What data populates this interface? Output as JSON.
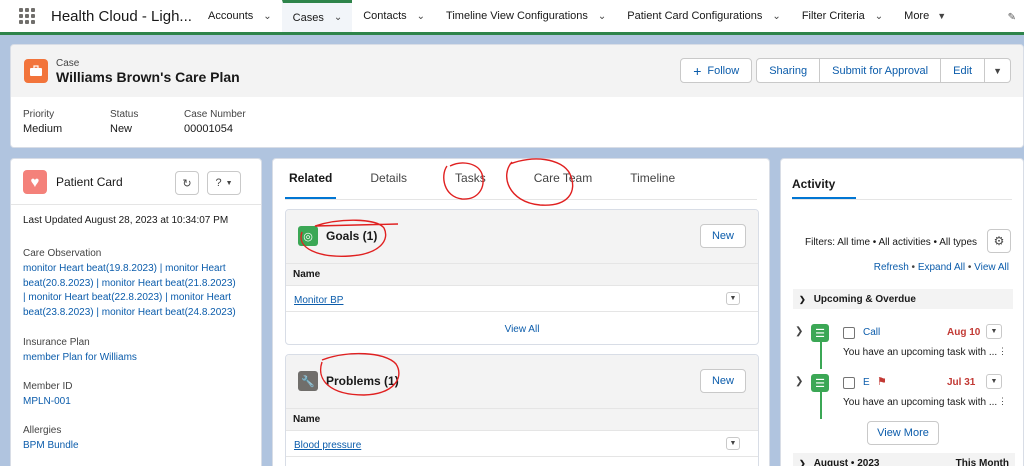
{
  "nav": {
    "app_name": "Health Cloud - Ligh...",
    "items": [
      {
        "label": "Accounts",
        "active": false
      },
      {
        "label": "Cases",
        "active": true
      },
      {
        "label": "Contacts",
        "active": false
      },
      {
        "label": "Timeline View Configurations",
        "active": false
      },
      {
        "label": "Patient Card Configurations",
        "active": false
      },
      {
        "label": "Filter Criteria",
        "active": false
      }
    ],
    "more_label": "More"
  },
  "record": {
    "object_type": "Case",
    "title": "Williams Brown's Care Plan",
    "follow_label": "Follow",
    "actions": [
      "Sharing",
      "Submit for Approval",
      "Edit"
    ],
    "fields": [
      {
        "label": "Priority",
        "value": "Medium"
      },
      {
        "label": "Status",
        "value": "New"
      },
      {
        "label": "Case Number",
        "value": "00001054"
      }
    ]
  },
  "patient_card": {
    "title": "Patient Card",
    "help_label": "?",
    "last_updated": "Last Updated August 28, 2023 at 10:34:07 PM",
    "care_observation": {
      "label": "Care Observation",
      "lines": [
        "monitor Heart beat(19.8.2023) | monitor Heart",
        "beat(20.8.2023) | monitor Heart beat(21.8.2023)",
        " | monitor Heart beat(22.8.2023) | monitor Heart",
        "beat(23.8.2023) | monitor Heart beat(24.8.2023)"
      ]
    },
    "insurance_plan": {
      "label": "Insurance Plan",
      "value": "member Plan for Williams"
    },
    "member_id": {
      "label": "Member ID",
      "value": "MPLN-001"
    },
    "allergies": {
      "label": "Allergies",
      "value": "BPM Bundle"
    }
  },
  "related": {
    "tabs": [
      "Related",
      "Details",
      "Tasks",
      "Care Team",
      "Timeline"
    ],
    "goals": {
      "title": "Goals (1)",
      "new_label": "New",
      "column": "Name",
      "rows": [
        "Monitor BP"
      ],
      "view_all": "View All"
    },
    "problems": {
      "title": "Problems (1)",
      "new_label": "New",
      "column": "Name",
      "rows": [
        "Blood pressure"
      ]
    }
  },
  "activity": {
    "tab": "Activity",
    "filters": "Filters: All time • All activities • All types",
    "links": [
      "Refresh",
      "Expand All",
      "View All"
    ],
    "section": "Upcoming & Overdue",
    "tasks": [
      {
        "name": "Call",
        "date": "Aug 10",
        "desc": "You have an upcoming task with ..."
      },
      {
        "name": "E",
        "date": "Jul 31",
        "desc": "You have an upcoming task with ..."
      }
    ],
    "view_more": "View More",
    "month": "August • 2023",
    "month_right": "This Month"
  },
  "colors": {
    "accent_green": "#2e844a",
    "link_blue": "#0b5cab",
    "case_icon": "#f2743b",
    "heart_icon": "#f4817a",
    "goal_icon": "#3ba755",
    "problem_icon": "#706e6b",
    "overdue_red": "#c23934",
    "annotation_red": "#e02020"
  }
}
